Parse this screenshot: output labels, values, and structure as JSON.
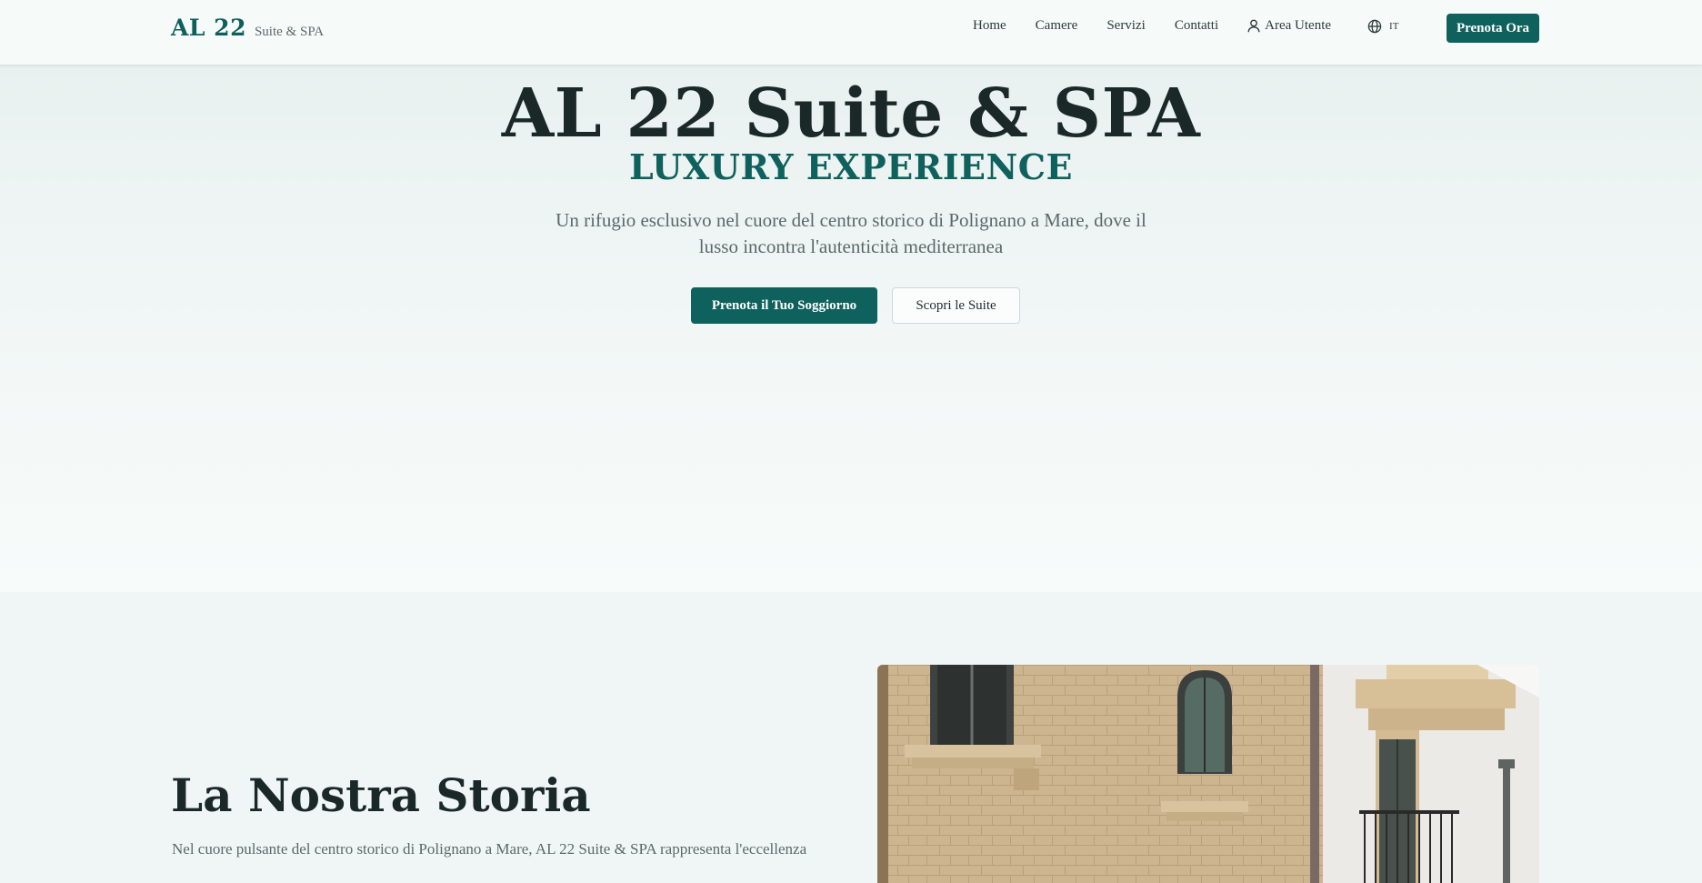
{
  "nav": {
    "logo_main": "AL 22",
    "logo_sub": "Suite & SPA",
    "links": [
      "Home",
      "Camere",
      "Servizi",
      "Contatti"
    ],
    "user_label": "Area Utente",
    "lang_label": "IT",
    "cta_label": "Prenota Ora"
  },
  "hero": {
    "title": "AL 22 Suite & SPA",
    "subtitle": "LUXURY EXPERIENCE",
    "description": "Un rifugio esclusivo nel cuore del centro storico di Polignano a Mare, dove il lusso incontra l'autenticità mediterranea",
    "primary_button": "Prenota il Tuo Soggiorno",
    "secondary_button": "Scopri le Suite"
  },
  "story": {
    "title": "La Nostra Storia",
    "text": "Nel cuore pulsante del centro storico di Polignano a Mare, AL 22 Suite & SPA rappresenta l'eccellenza"
  },
  "colors": {
    "brand": "#0e615c",
    "heading": "#1a2928",
    "body_text": "#5c6968",
    "background": "#f0f6f5"
  },
  "icons": {
    "user": "user-icon",
    "language": "globe-icon"
  }
}
